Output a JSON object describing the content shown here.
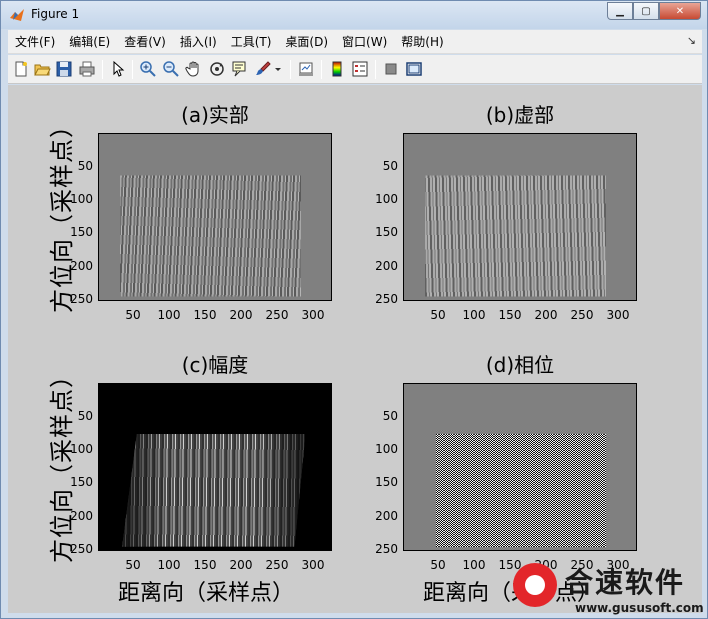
{
  "window": {
    "title": "Figure 1"
  },
  "menu": [
    "文件(F)",
    "编辑(E)",
    "查看(V)",
    "插入(I)",
    "工具(T)",
    "桌面(D)",
    "窗口(W)",
    "帮助(H)"
  ],
  "toolbar": [
    "new-figure-icon",
    "open-file-icon",
    "save-icon",
    "print-icon",
    "edit-plot-arrow-icon",
    "zoom-in-icon",
    "zoom-out-icon",
    "pan-hand-icon",
    "rotate-3d-icon",
    "data-cursor-icon",
    "brush-icon",
    "link-plot-icon",
    "insert-colorbar-icon",
    "insert-legend-icon",
    "hide-plot-tools-icon",
    "show-plot-tools-icon"
  ],
  "plots": [
    {
      "title": "(a)实部",
      "ylabel": "方位向（采样点）"
    },
    {
      "title": "(b)虚部"
    },
    {
      "title": "(c)幅度",
      "ylabel": "方位向（采样点）",
      "xlabel": "距离向（采样点）"
    },
    {
      "title": "(d)相位",
      "xlabel": "距离向（采样点）"
    }
  ],
  "ticks": {
    "y": [
      "50",
      "100",
      "150",
      "200",
      "250"
    ],
    "x": [
      "50",
      "100",
      "150",
      "200",
      "250",
      "300"
    ]
  },
  "watermark": {
    "name": "合速软件",
    "url": "www.gususoft.com"
  }
}
